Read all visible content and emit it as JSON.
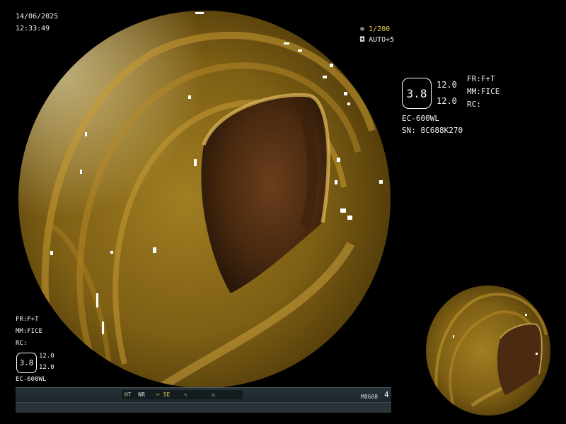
{
  "overlay": {
    "date": "14/06/2025",
    "time": "12:33:49",
    "shutter_speed": "1/200",
    "exposure_mode": "AUTO+5"
  },
  "right_panel": {
    "enhancement_level": "3.8",
    "value_1": "12.0",
    "value_2": "12.0",
    "fr_label": "FR:F+T",
    "mm_label": "MM:FICE",
    "rc_label": "RC:",
    "scope_model": "EC-600WL",
    "serial_number": "SN: 8C688K270"
  },
  "left_panel": {
    "fr_label": "FR:F+T",
    "mm_label": "MM:FICE",
    "rc_label": "RC:",
    "enhancement_level": "3.8",
    "value_1": "12.0",
    "value_2": "12.0",
    "scope_model": "EC-600WL"
  },
  "status_bar": {
    "ht_label": "HT",
    "nr_label": "NR",
    "se_label": "SE",
    "code": "M8608",
    "number": "4"
  },
  "icons": [
    "snowflake-icon",
    "camera-icon",
    "scissors-icon",
    "pen-icon",
    "target-icon"
  ],
  "colors": {
    "background": "#000000",
    "tissue": "#8a6a1a",
    "status_bar": "#1c262c",
    "status_text": "#9fd29a",
    "shutter_text": "#e8d24a"
  }
}
